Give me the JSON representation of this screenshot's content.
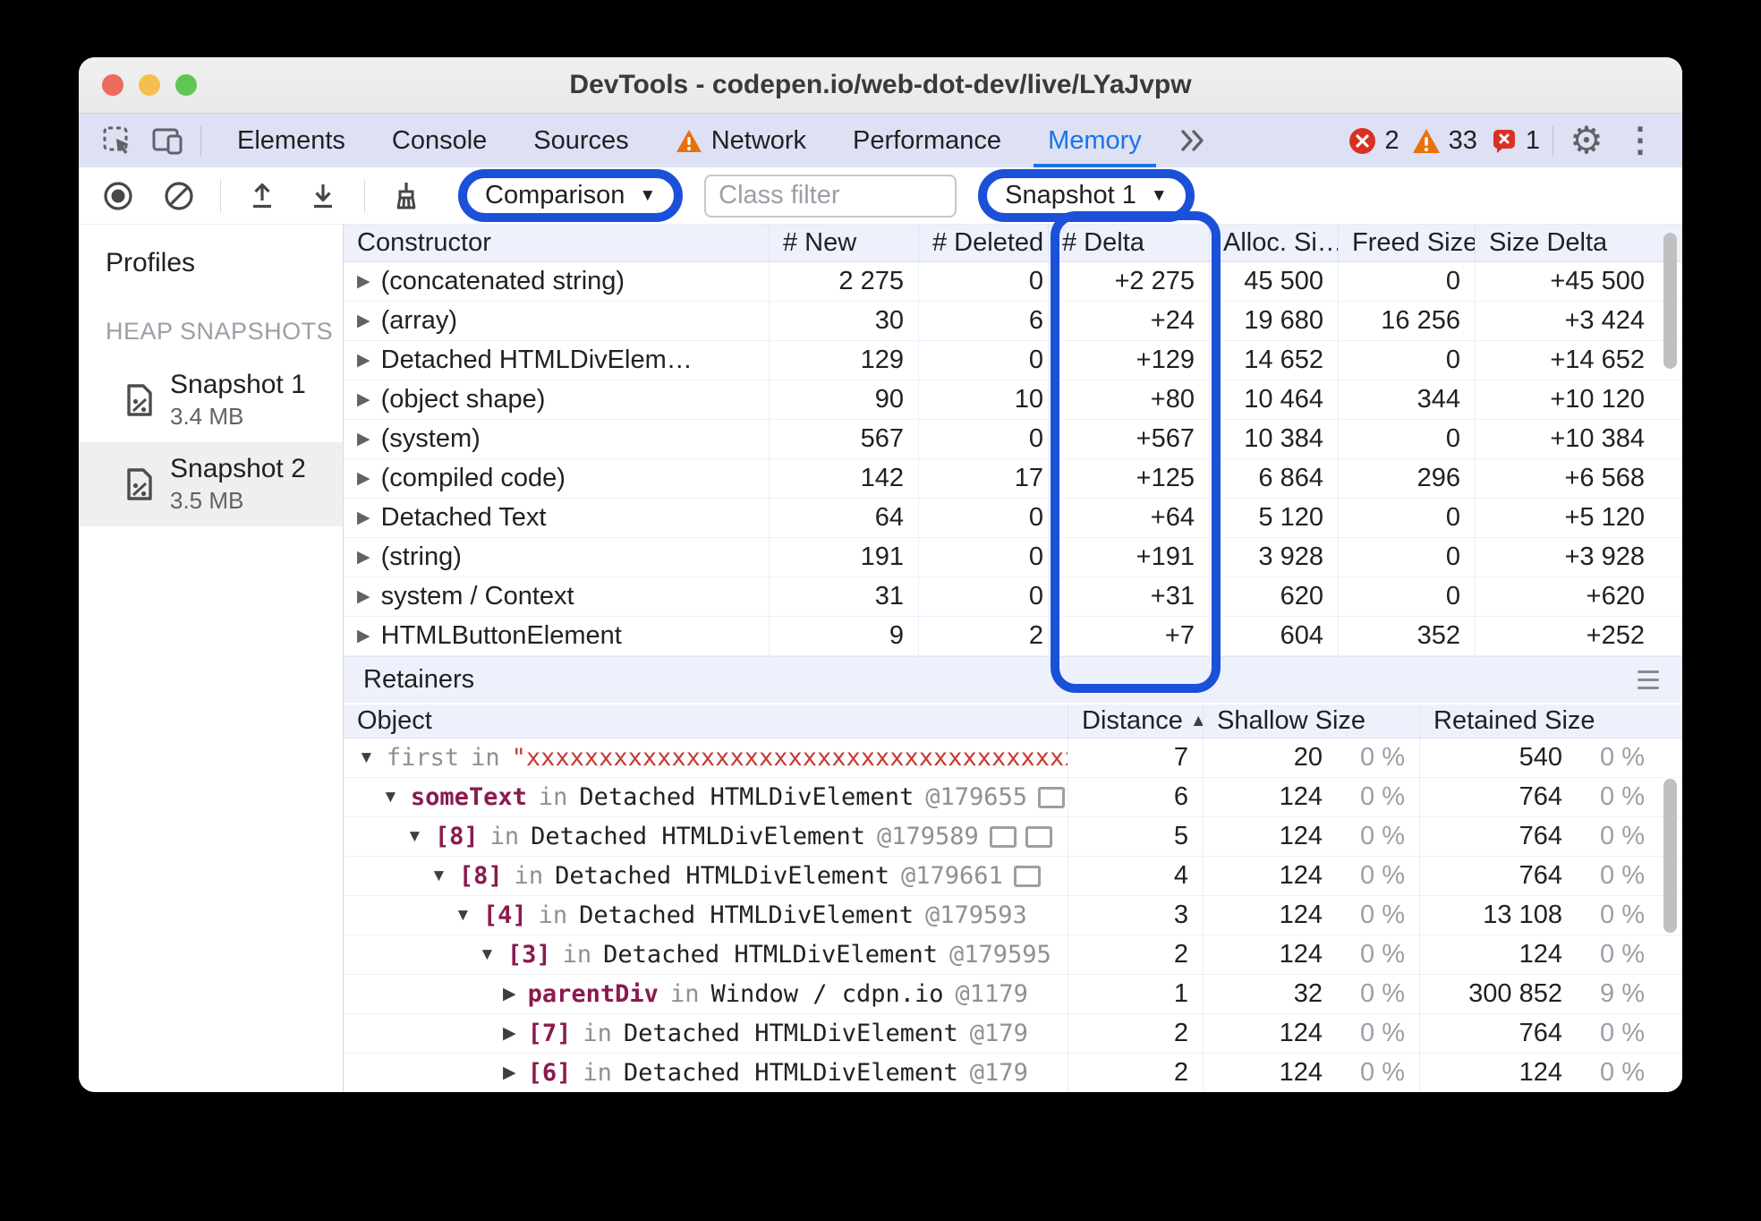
{
  "window": {
    "title": "DevTools - codepen.io/web-dot-dev/live/LYaJvpw"
  },
  "colors": {
    "annotation_blue": "#1b50d8",
    "active_tab_blue": "#1a73e8",
    "error_red": "#d93025",
    "warning_orange": "#e8710a",
    "property_maroon": "#8a1a4f",
    "string_red": "#c9382d",
    "header_lavender": "#eef1fb"
  },
  "icons": {
    "dropdown": "▼",
    "sort_desc": "▼",
    "sort_asc": "▲",
    "collapse": "▼",
    "expand": "▶",
    "kebab": "⋮",
    "gear": "⚙"
  },
  "tabbar": {
    "tabs": [
      "Elements",
      "Console",
      "Sources",
      "Network",
      "Performance",
      "Memory"
    ],
    "error_count": "2",
    "warning_count": "33",
    "issue_count": "1"
  },
  "toolbar": {
    "comparison_label": "Comparison",
    "class_filter_placeholder": "Class filter",
    "snapshot_label": "Snapshot 1"
  },
  "sidebar": {
    "profiles_label": "Profiles",
    "section_label": "HEAP SNAPSHOTS",
    "snapshots": [
      {
        "name": "Snapshot 1",
        "size": "3.4 MB"
      },
      {
        "name": "Snapshot 2",
        "size": "3.5 MB"
      }
    ]
  },
  "comparison_table": {
    "columns": [
      "Constructor",
      "# New",
      "# Deleted",
      "# Delta",
      "Alloc. Si…",
      "Freed Size",
      "Size Delta"
    ],
    "rows": [
      {
        "c": "(concatenated string)",
        "nw": "2 275",
        "del": "0",
        "dl": "+2 275",
        "al": "45 500",
        "fr": "0",
        "sd": "+45 500"
      },
      {
        "c": "(array)",
        "nw": "30",
        "del": "6",
        "dl": "+24",
        "al": "19 680",
        "fr": "16 256",
        "sd": "+3 424"
      },
      {
        "c": "Detached HTMLDivElem…",
        "nw": "129",
        "del": "0",
        "dl": "+129",
        "al": "14 652",
        "fr": "0",
        "sd": "+14 652"
      },
      {
        "c": "(object shape)",
        "nw": "90",
        "del": "10",
        "dl": "+80",
        "al": "10 464",
        "fr": "344",
        "sd": "+10 120"
      },
      {
        "c": "(system)",
        "nw": "567",
        "del": "0",
        "dl": "+567",
        "al": "10 384",
        "fr": "0",
        "sd": "+10 384"
      },
      {
        "c": "(compiled code)",
        "nw": "142",
        "del": "17",
        "dl": "+125",
        "al": "6 864",
        "fr": "296",
        "sd": "+6 568"
      },
      {
        "c": "Detached Text",
        "nw": "64",
        "del": "0",
        "dl": "+64",
        "al": "5 120",
        "fr": "0",
        "sd": "+5 120"
      },
      {
        "c": "(string)",
        "nw": "191",
        "del": "0",
        "dl": "+191",
        "al": "3 928",
        "fr": "0",
        "sd": "+3 928"
      },
      {
        "c": "system / Context",
        "nw": "31",
        "del": "0",
        "dl": "+31",
        "al": "620",
        "fr": "0",
        "sd": "+620"
      },
      {
        "c": "HTMLButtonElement",
        "nw": "9",
        "del": "2",
        "dl": "+7",
        "al": "604",
        "fr": "352",
        "sd": "+252"
      }
    ]
  },
  "retainers": {
    "title": "Retainers",
    "columns": [
      "Object",
      "Distance",
      "Shallow Size",
      "Retained Size"
    ],
    "rows": [
      {
        "ar": "▼",
        "nm": "first",
        "inw": "in",
        "tg": "\"xxxxxxxxxxxxxxxxxxxxxxxxxxxxxxxxxxxxxxxxxxxxxxxxxxxx",
        "ad": "",
        "di": "7",
        "sh": "20",
        "shp": "0 %",
        "rt": "540",
        "rtp": "0 %"
      },
      {
        "ar": "▼",
        "nm": "someText",
        "inw": "in",
        "tg": "Detached HTMLDivElement",
        "ad": "@179655",
        "di": "6",
        "sh": "124",
        "shp": "0 %",
        "rt": "764",
        "rtp": "0 %"
      },
      {
        "ar": "▼",
        "nm": "[8]",
        "inw": "in",
        "tg": "Detached HTMLDivElement",
        "ad": "@179589",
        "di": "5",
        "sh": "124",
        "shp": "0 %",
        "rt": "764",
        "rtp": "0 %"
      },
      {
        "ar": "▼",
        "nm": "[8]",
        "inw": "in",
        "tg": "Detached HTMLDivElement",
        "ad": "@179661",
        "di": "4",
        "sh": "124",
        "shp": "0 %",
        "rt": "764",
        "rtp": "0 %"
      },
      {
        "ar": "▼",
        "nm": "[4]",
        "inw": "in",
        "tg": "Detached HTMLDivElement",
        "ad": "@179593",
        "di": "3",
        "sh": "124",
        "shp": "0 %",
        "rt": "13 108",
        "rtp": "0 %"
      },
      {
        "ar": "▼",
        "nm": "[3]",
        "inw": "in",
        "tg": "Detached HTMLDivElement",
        "ad": "@179595",
        "di": "2",
        "sh": "124",
        "shp": "0 %",
        "rt": "124",
        "rtp": "0 %"
      },
      {
        "ar": "▶",
        "nm": "parentDiv",
        "inw": "in",
        "tg": "Window / cdpn.io",
        "ad": "@1179",
        "di": "1",
        "sh": "32",
        "shp": "0 %",
        "rt": "300 852",
        "rtp": "9 %"
      },
      {
        "ar": "▶",
        "nm": "[7]",
        "inw": "in",
        "tg": "Detached HTMLDivElement",
        "ad": "@179",
        "di": "2",
        "sh": "124",
        "shp": "0 %",
        "rt": "764",
        "rtp": "0 %"
      },
      {
        "ar": "▶",
        "nm": "[6]",
        "inw": "in",
        "tg": "Detached HTMLDivElement",
        "ad": "@179",
        "di": "2",
        "sh": "124",
        "shp": "0 %",
        "rt": "124",
        "rtp": "0 %"
      }
    ]
  }
}
